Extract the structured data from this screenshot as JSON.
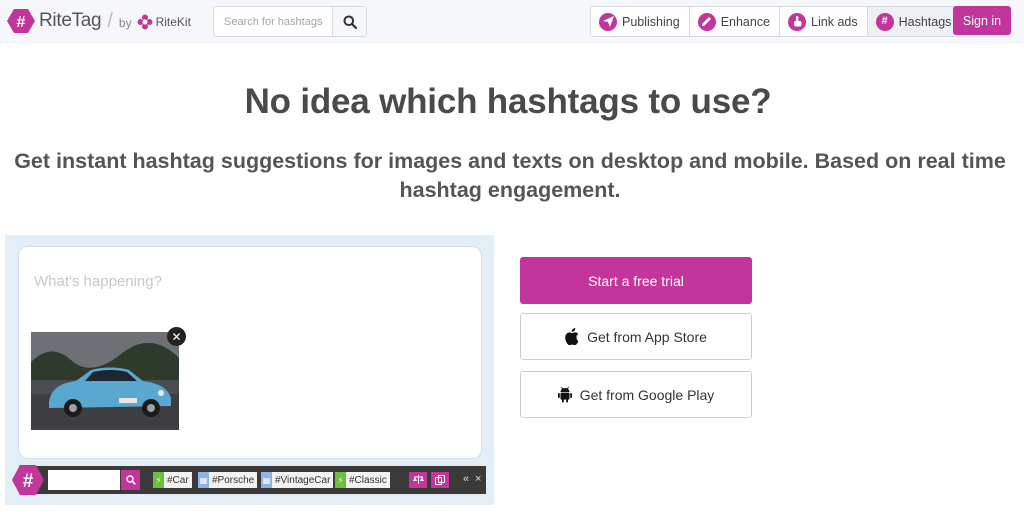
{
  "header": {
    "logo_text": "RiteTag",
    "by_text": "by",
    "partner_text": "RiteKit",
    "search_placeholder": "Search for hashtags",
    "nav": [
      {
        "label": "Publishing",
        "icon": "paper-plane-icon"
      },
      {
        "label": "Enhance",
        "icon": "pencil-icon"
      },
      {
        "label": "Link ads",
        "icon": "hand-pointer-icon"
      },
      {
        "label": "Hashtags",
        "icon": "hashtag-icon"
      }
    ],
    "signin_label": "Sign in"
  },
  "hero": {
    "title": "No idea which hashtags to use?",
    "subtitle": "Get instant hashtag suggestions for images and texts on desktop and mobile. Based on real time hashtag engagement."
  },
  "composer": {
    "placeholder": "What's happening?",
    "image": "blue-vintage-porsche-photo",
    "tags": [
      {
        "label": "#Car",
        "color": "#6cbf3f"
      },
      {
        "label": "#Porsche",
        "color": "#8fb4e3"
      },
      {
        "label": "#VintageCar",
        "color": "#8fb4e3"
      },
      {
        "label": "#Classic",
        "color": "#6cbf3f"
      }
    ]
  },
  "cta": {
    "trial_label": "Start a free trial",
    "appstore_label": "Get from App Store",
    "googleplay_label": "Get from Google Play"
  },
  "colors": {
    "brand": "#c2359b",
    "panel_bg": "#e3eef7"
  }
}
